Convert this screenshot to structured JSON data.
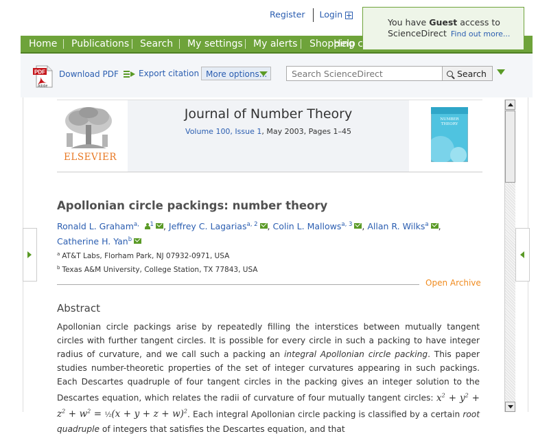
{
  "top_links": {
    "register": "Register",
    "login": "Login"
  },
  "guest_box": {
    "line1_prefix": "You have",
    "line1_bold": "Guest",
    "line1_suffix": "access to",
    "line2": "ScienceDirect",
    "find_out_more": "Find out more..."
  },
  "nav": {
    "items": [
      "Home",
      "Publications",
      "Search",
      "My settings",
      "My alerts",
      "Shopping cart",
      "Help"
    ]
  },
  "toolbar": {
    "download_pdf": "Download PDF",
    "export_citation": "Export citation",
    "more_options": "More options...",
    "search_placeholder": "Search ScienceDirect",
    "search_button": "Search"
  },
  "journal": {
    "title": "Journal of Number Theory",
    "volume_issue": "Volume 100, Issue 1",
    "date_pages": ", May 2003, Pages 1–45",
    "publisher": "ELSEVIER",
    "cover_label": "NUMBER THEORY"
  },
  "article": {
    "title": "Apollonian circle packings: number theory",
    "authors_line1": [
      {
        "name": "Ronald L. Graham",
        "sup": "a, ",
        "extra": "1"
      },
      {
        "name": "Jeffrey C. Lagarias",
        "sup": "a, 2"
      },
      {
        "name": "Colin L. Mallows",
        "sup": "a, 3"
      },
      {
        "name": "Allan R. Wilks",
        "sup": "a"
      }
    ],
    "authors_line2": [
      {
        "name": "Catherine H. Yan",
        "sup": "b"
      }
    ],
    "affiliations": [
      {
        "mark": "a",
        "text": "AT&T Labs, Florham Park, NJ 07932-0971, USA"
      },
      {
        "mark": "b",
        "text": "Texas A&M University, College Station, TX 77843, USA"
      }
    ],
    "open_archive": "Open Archive",
    "abstract_heading": "Abstract",
    "abstract_p1": "Apollonian circle packings arise by repeatedly filling the interstices between mutually tangent circles with further tangent circles. It is possible for every circle in such a packing to have integer radius of curvature, and we call such a packing an",
    "abstract_em1": "integral Apollonian circle packing",
    "abstract_p2": ". This paper studies number-theoretic properties of the set of integer curvatures appearing in such packings. Each Descartes quadruple of four tangent circles in the packing gives an integer solution to the Descartes equation, which relates the radii of curvature of four mutually tangent circles:",
    "abstract_p3": ". Each integral Apollonian circle packing is classified by a certain",
    "abstract_em2": "root quadruple",
    "abstract_p4": "of integers that satisfies the Descartes equation, and that"
  }
}
